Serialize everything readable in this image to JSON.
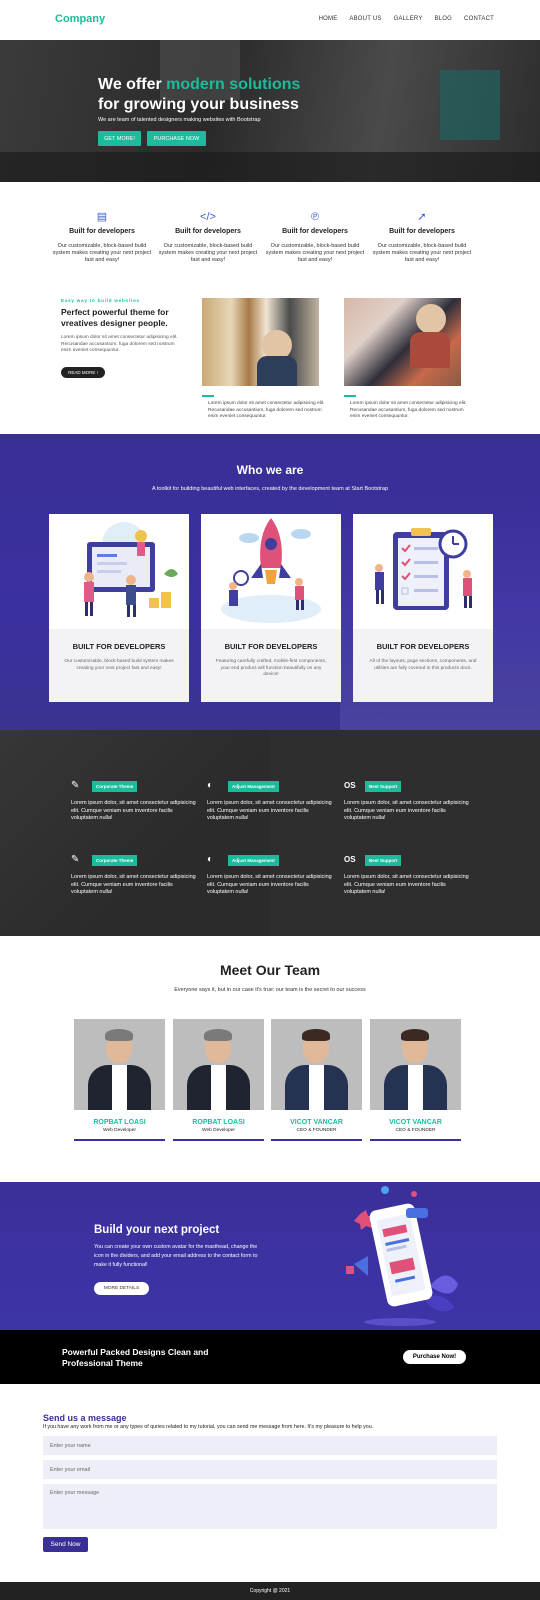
{
  "nav": {
    "brand": "Company",
    "items": [
      "HOME",
      "ABOUT US",
      "GALLERY",
      "BLOG",
      "CONTACT"
    ]
  },
  "hero": {
    "title_part1": "We offer ",
    "title_accent": "modern solutions",
    "title_line2": "for growing your business",
    "subtitle": "We are team of talented designers making websites with Bootstrap",
    "btn_primary": "GET MORE!",
    "btn_secondary": "PURCHASE NOW"
  },
  "features": [
    {
      "icon": "newspaper-icon",
      "glyph": "▤",
      "title": "Built for developers",
      "text": "Our customizable, block-based build system makes creating your next project fast and easy!"
    },
    {
      "icon": "code-icon",
      "glyph": "</>",
      "title": "Built for developers",
      "text": "Our customizable, block-based build system makes creating your next project fast and easy!"
    },
    {
      "icon": "pinterest-icon",
      "glyph": "℗",
      "title": "Built for developers",
      "text": "Our customizable, block-based build system makes creating your next project fast and easy!"
    },
    {
      "icon": "rocket-icon",
      "glyph": "➚",
      "title": "Built for developers",
      "text": "Our customizable, block-based build system makes creating your next project fast and easy!"
    }
  ],
  "about": {
    "kicker": "Easy way to build websites",
    "title": "Perfect powerful theme for vreatives designer people.",
    "text": "Lorem ipsum dolor sit amet consectetur adipisicing elit. Recusandae accusantium, fuga dolorem sed nostrum enim eveniet consequuntur.",
    "button": "READ MORE !",
    "captions": [
      "Lorem ipsum dolor sit amet consectetur adipisicing elit. Recusandae accusantium, fuga dolorem sed nostrum enim eveniet consequuntur.",
      "Lorem ipsum dolor sit amet consectetur adipisicing elit. Recusandae accusantium, fuga dolorem sed nostrum enim eveniet consequuntur."
    ]
  },
  "who": {
    "title": "Who we are",
    "subtitle": "A toolkit for building beautiful web interfaces, created by the development team at Start Bootstrap",
    "cards": [
      {
        "title": "BUILT FOR DEVELOPERS",
        "text": "Our customizable, block-based build system makes creating your next project fast and easy!"
      },
      {
        "title": "BUILT FOR DEVELOPERS",
        "text": "Featuring carefully crafted, mobile-first components, your end product will function beautifully on any device!"
      },
      {
        "title": "BUILT FOR DEVELOPERS",
        "text": "All of the layouts, page sections, components, and utilities are fully covered in this products docs."
      }
    ]
  },
  "services": [
    {
      "icon": "edit-icon",
      "glyph": "✎",
      "badge": "Corporate Theme",
      "text": "Lorem ipsum dolor, sit amet consectetur adipisicing elit. Cumque veniam eum inventore facilis voluptatem nulla!"
    },
    {
      "icon": "contrast-icon",
      "glyph": "◐",
      "badge": "Adjust Management",
      "text": "Lorem ipsum dolor, sit amet consectetur adipisicing elit. Cumque veniam eum inventore facilis voluptatem nulla!"
    },
    {
      "icon": "os-icon",
      "glyph": "OS",
      "badge": "Best Support",
      "text": "Lorem ipsum dolor, sit amet consectetur adipisicing elit. Cumque veniam eum inventore facilis voluptatem nulla!"
    },
    {
      "icon": "edit-icon",
      "glyph": "✎",
      "badge": "Corporate Theme",
      "text": "Lorem ipsum dolor, sit amet consectetur adipisicing elit. Cumque veniam eum inventore facilis voluptatem nulla!"
    },
    {
      "icon": "contrast-icon",
      "glyph": "◐",
      "badge": "Adjust Management",
      "text": "Lorem ipsum dolor, sit amet consectetur adipisicing elit. Cumque veniam eum inventore facilis voluptatem nulla!"
    },
    {
      "icon": "os-icon",
      "glyph": "OS",
      "badge": "Best Support",
      "text": "Lorem ipsum dolor, sit amet consectetur adipisicing elit. Cumque veniam eum inventore facilis voluptatem nulla!"
    }
  ],
  "team": {
    "title": "Meet Our Team",
    "subtitle": "Everyone says it, but in our case it's true: our team is the secret to our success",
    "members": [
      {
        "name": "ROPBAT LOASI",
        "role": "Web Developer"
      },
      {
        "name": "ROPBAT LOASI",
        "role": "Web Developer"
      },
      {
        "name": "VICOT VANCAR",
        "role": "CEO & FOUNDER"
      },
      {
        "name": "VICOT VANCAR",
        "role": "CEO & FOUNDER"
      }
    ]
  },
  "build": {
    "title": "Build your next project",
    "text": "You can create your own custom avatar for the masthead, change the icon in the dividers, and add your email address to the contact form to make it fully functional!",
    "button": "MORE DETAILS"
  },
  "banner": {
    "text": "Powerful Packed Designs Clean and Professional Theme",
    "button": "Purchase Now!"
  },
  "contact": {
    "title": "Send us a message",
    "subtitle": "If you have any work from me or any types of quries related to my tutorial, you can send me message from here. It's my pleasure to help you.",
    "name_placeholder": "Enter your name",
    "email_placeholder": "Enter your email",
    "message_placeholder": "Enter your message",
    "send": "Send Now"
  },
  "footer": {
    "copyright": "Copyright @ 2021"
  },
  "colors": {
    "accent": "#1abc9c",
    "purple": "#3a2f96",
    "dark": "#2e2e2e"
  }
}
